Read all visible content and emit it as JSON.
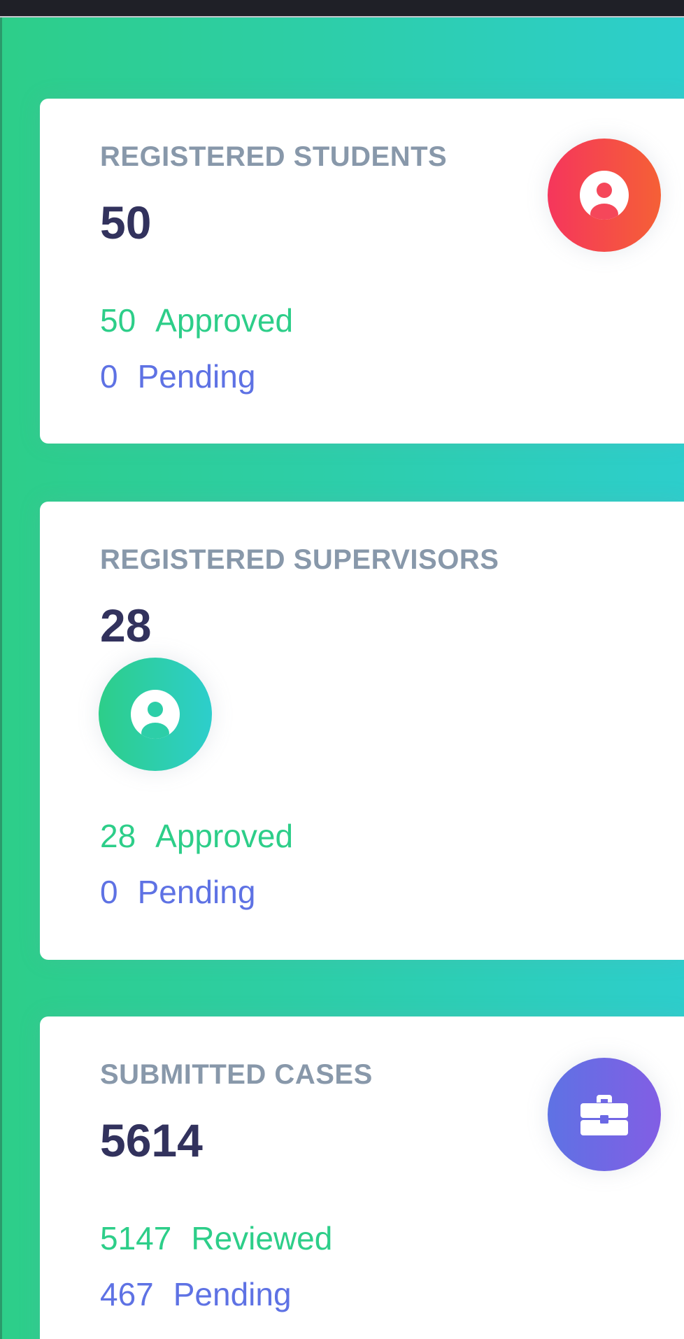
{
  "cards": [
    {
      "title": "REGISTERED STUDENTS",
      "value": "50",
      "stat1": {
        "number": "50",
        "label": "Approved"
      },
      "stat2": {
        "number": "0",
        "label": "Pending"
      },
      "icon": "user-circle-icon"
    },
    {
      "title": "REGISTERED SUPERVISORS",
      "value": "28",
      "stat1": {
        "number": "28",
        "label": "Approved"
      },
      "stat2": {
        "number": "0",
        "label": "Pending"
      },
      "icon": "user-circle-icon"
    },
    {
      "title": "SUBMITTED CASES",
      "value": "5614",
      "stat1": {
        "number": "5147",
        "label": "Reviewed"
      },
      "stat2": {
        "number": "467",
        "label": "Pending"
      },
      "icon": "briefcase-icon"
    }
  ],
  "colors": {
    "banner_start": "#2dce89",
    "banner_end": "#2dcecc",
    "title": "#8898aa",
    "value": "#32325d",
    "positive": "#2dce89",
    "pending": "#5e72e4",
    "icon_red_start": "#f5365c",
    "icon_red_end": "#f56036",
    "icon_purple_start": "#5e72e4",
    "icon_purple_end": "#825ee4"
  }
}
